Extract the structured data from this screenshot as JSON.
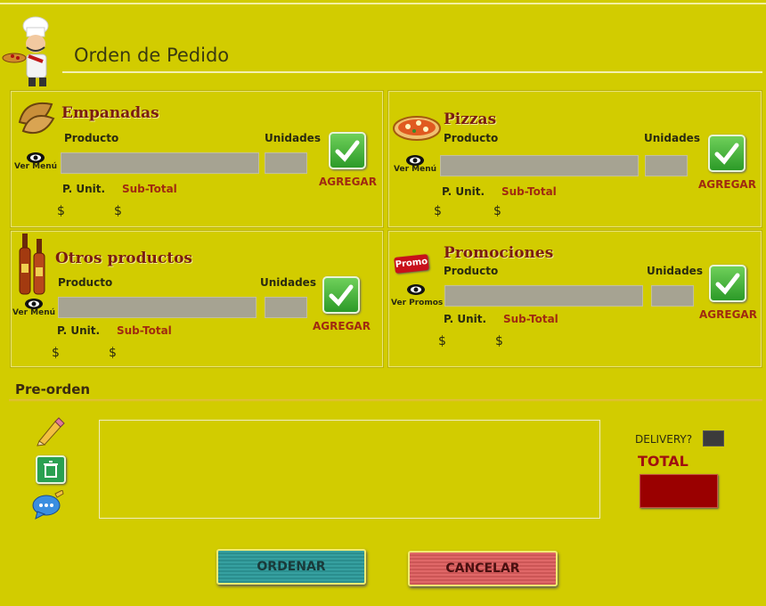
{
  "window": {
    "title": "Orden de  Pedido"
  },
  "panels": {
    "empanadas": {
      "title": "Empanadas",
      "producto": "Producto",
      "unidades": "Unidades",
      "ver": "Ver Menú",
      "punit": "P. Unit.",
      "subtotal": "Sub-Total",
      "d1": "$",
      "d2": "$",
      "agregar": "AGREGAR"
    },
    "pizzas": {
      "title": "Pizzas",
      "producto": "Producto",
      "unidades": "Unidades",
      "ver": "Ver Menú",
      "punit": "P. Unit.",
      "subtotal": "Sub-Total",
      "d1": "$",
      "d2": "$",
      "agregar": "AGREGAR"
    },
    "otros": {
      "title": "Otros productos",
      "producto": "Producto",
      "unidades": "Unidades",
      "ver": "Ver Menú",
      "punit": "P. Unit.",
      "subtotal": "Sub-Total",
      "d1": "$",
      "d2": "$",
      "agregar": "AGREGAR"
    },
    "promociones": {
      "title": "Promociones",
      "producto": "Producto",
      "unidades": "Unidades",
      "ver": "Ver Promos",
      "punit": "P. Unit.",
      "subtotal": "Sub-Total",
      "d1": "$",
      "d2": "$",
      "agregar": "AGREGAR",
      "promo_tag": "Promo"
    }
  },
  "preorden": {
    "title": "Pre-orden",
    "delivery": "DELIVERY?",
    "total": "TOTAL"
  },
  "buttons": {
    "ordenar": "ORDENAR",
    "cancelar": "CANCELAR"
  },
  "icons": {
    "chef": "chef-icon",
    "pencil": "pencil-icon",
    "trash": "trash-icon",
    "comment": "comment-icon",
    "eye": "eye-icon",
    "check": "check-icon"
  },
  "colors": {
    "background": "#d2cc00",
    "title_red": "#7a1c10",
    "total_box": "#9a0000",
    "ordenar": "#36a0a0",
    "cancelar": "#e06868"
  }
}
